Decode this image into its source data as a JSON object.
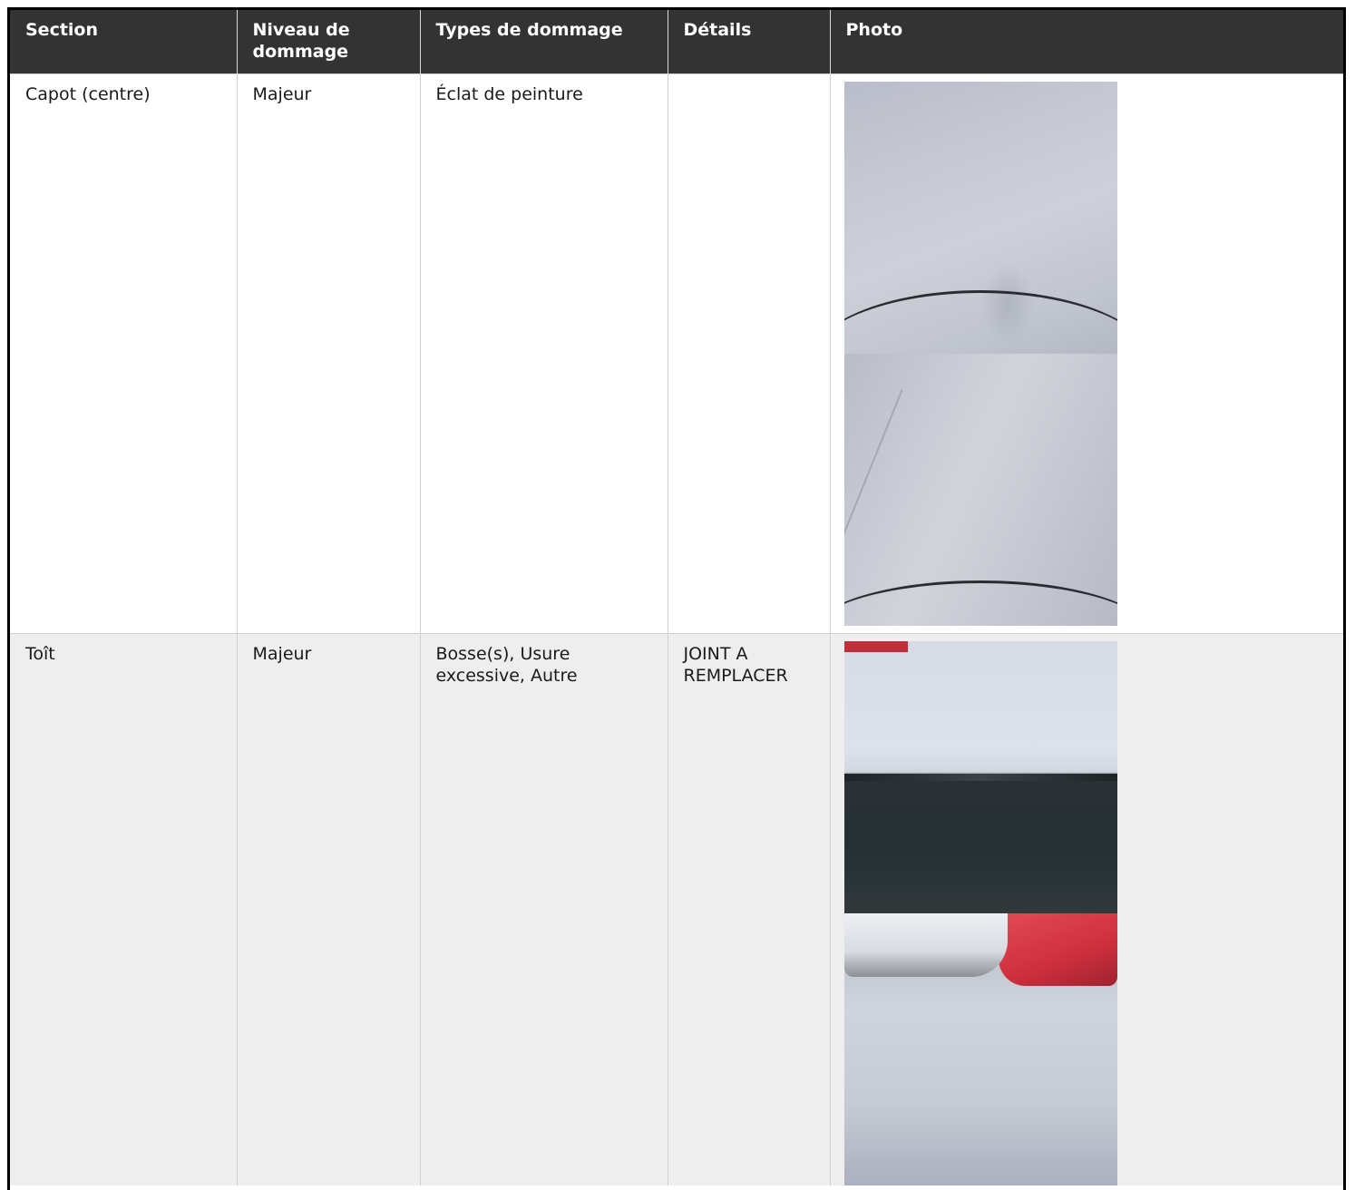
{
  "table": {
    "headers": [
      "Section",
      "Niveau de dommage",
      "Types de dommage",
      "Détails",
      "Photo"
    ],
    "rows": [
      {
        "section": "Capot (centre)",
        "niveau": "Majeur",
        "types": "Éclat de peinture",
        "details": "",
        "photos": [
          "hood-photo-1",
          "hood-photo-2"
        ]
      },
      {
        "section": "Toît",
        "niveau": "Majeur",
        "types": "Bosse(s), Usure excessive, Autre",
        "details": "JOINT A REMPLACER",
        "photos": [
          "roof-photo-1",
          "roof-photo-2"
        ]
      }
    ]
  },
  "colors": {
    "header_bg": "#333333",
    "header_text": "#ffffff",
    "row_alt_bg": "#eeeeee"
  }
}
